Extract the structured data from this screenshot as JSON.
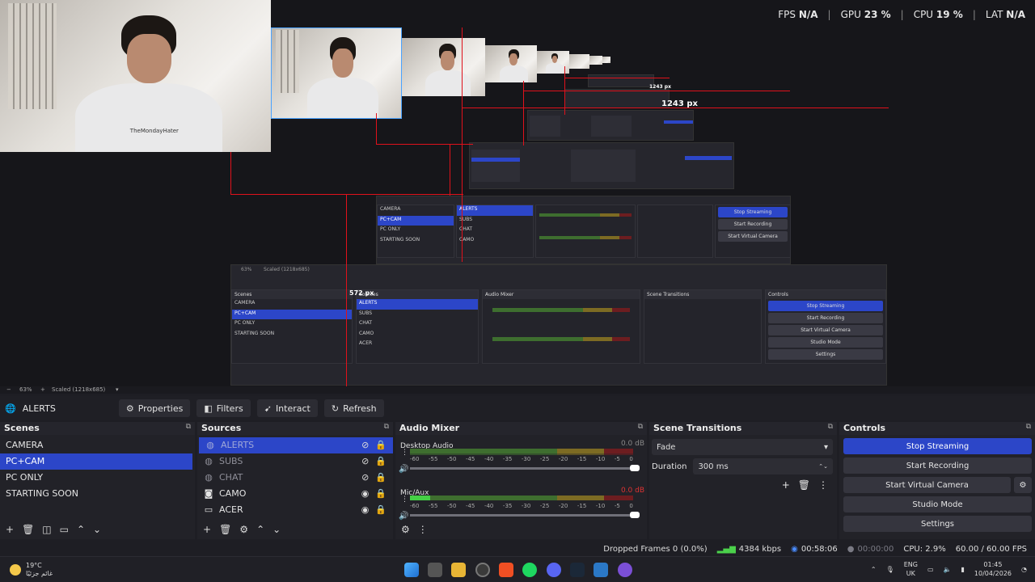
{
  "preview": {
    "stats": {
      "fps_label": "FPS",
      "fps_value": "N/A",
      "gpu_label": "GPU",
      "gpu_value": "23 %",
      "cpu_label": "CPU",
      "cpu_value": "19 %",
      "lat_label": "LAT",
      "lat_value": "N/A"
    },
    "cam_logo": "TheMondayHater",
    "px_label_large": "1243 px",
    "px_label_small": "1243 px",
    "px_label_572": "572 px",
    "nested_zoom": "63%",
    "nested_scaled": "Scaled (1218x685)",
    "nested_scenes": [
      "CAMERA",
      "PC+CAM",
      "PC ONLY",
      "STARTING SOON"
    ],
    "nested_sources": [
      "ALERTS",
      "SUBS",
      "CHAT",
      "CAMO",
      "ACER"
    ],
    "nested_controls": [
      "Stop Streaming",
      "Start Recording",
      "Start Virtual Camera",
      "Studio Mode",
      "Settings"
    ]
  },
  "zoombar": {
    "zoom": "63%",
    "scale": "Scaled (1218x685)"
  },
  "source_toolbar": {
    "source_name": "ALERTS",
    "properties": "Properties",
    "filters": "Filters",
    "interact": "Interact",
    "refresh": "Refresh"
  },
  "scenes": {
    "title": "Scenes",
    "items": [
      {
        "label": "CAMERA"
      },
      {
        "label": "PC+CAM"
      },
      {
        "label": "PC ONLY"
      },
      {
        "label": "STARTING SOON"
      }
    ]
  },
  "sources": {
    "title": "Sources",
    "items": [
      {
        "label": "ALERTS",
        "icon": "globe-icon"
      },
      {
        "label": "SUBS",
        "icon": "globe-icon"
      },
      {
        "label": "CHAT",
        "icon": "globe-icon"
      },
      {
        "label": "CAMO",
        "icon": "camera-icon"
      },
      {
        "label": "ACER",
        "icon": "monitor-icon"
      }
    ]
  },
  "audio_mixer": {
    "title": "Audio Mixer",
    "channels": [
      {
        "name": "Desktop Audio",
        "db": "0.0 dB",
        "level": 0
      },
      {
        "name": "Mic/Aux",
        "db": "0.0 dB",
        "level": 0.09
      }
    ],
    "ticks": [
      "-60",
      "-55",
      "-50",
      "-45",
      "-40",
      "-35",
      "-30",
      "-25",
      "-20",
      "-15",
      "-10",
      "-5",
      "0"
    ]
  },
  "scene_transitions": {
    "title": "Scene Transitions",
    "transition": "Fade",
    "duration_label": "Duration",
    "duration_value": "300 ms"
  },
  "controls": {
    "title": "Controls",
    "stop_streaming": "Stop Streaming",
    "start_recording": "Start Recording",
    "start_virtual_camera": "Start Virtual Camera",
    "studio_mode": "Studio Mode",
    "settings": "Settings"
  },
  "status": {
    "dropped": "Dropped Frames 0 (0.0%)",
    "bitrate": "4384 kbps",
    "stream_time": "00:58:06",
    "rec_time": "00:00:00",
    "cpu": "CPU: 2.9%",
    "fps": "60.00 / 60.00 FPS"
  },
  "taskbar": {
    "temp": "19°C",
    "weather_desc": "غائم جزئيًا",
    "lang1": "ENG",
    "lang2": "UK",
    "time": "01:45",
    "date": "10/04/2026"
  }
}
